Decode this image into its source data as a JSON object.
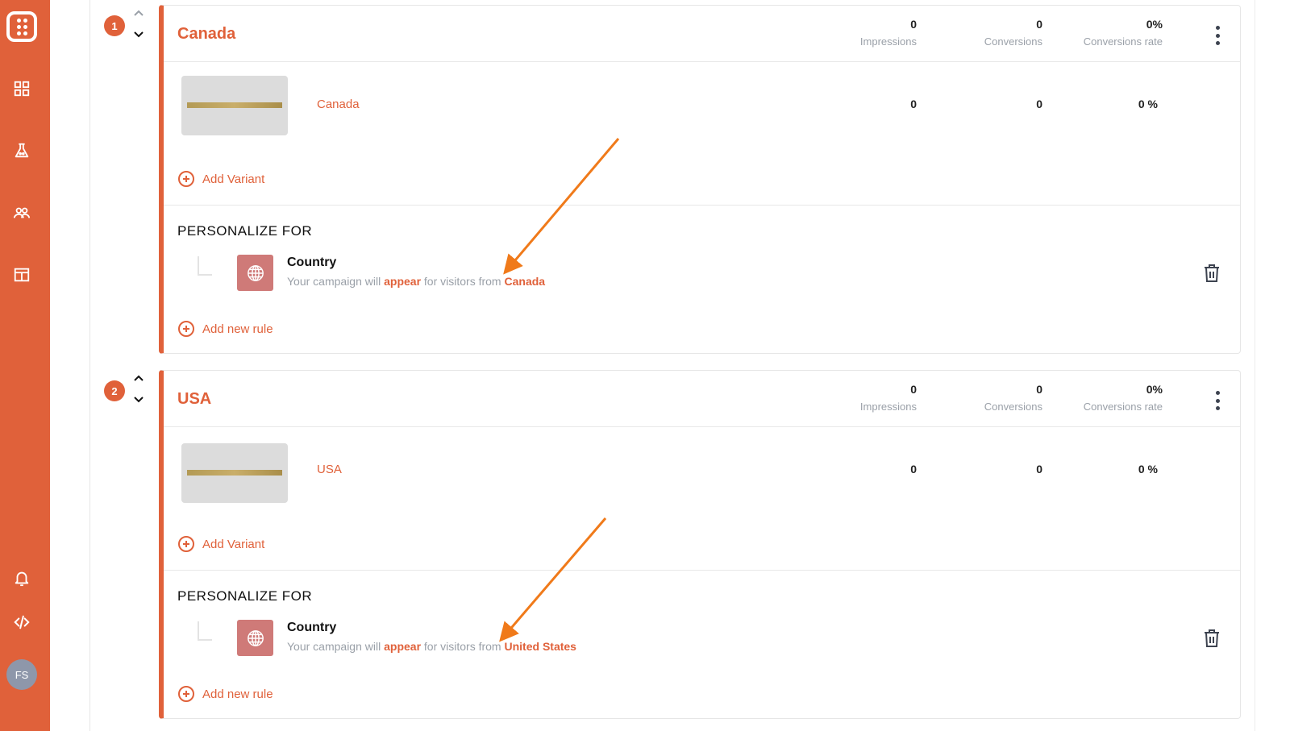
{
  "sidebar": {
    "logo": "dice-logo",
    "items": [
      {
        "icon": "dashboard-grid-icon"
      },
      {
        "icon": "flask-experiment-icon"
      },
      {
        "icon": "users-icon"
      },
      {
        "icon": "layout-template-icon"
      }
    ],
    "bottom": [
      {
        "icon": "bell-icon"
      },
      {
        "icon": "code-icon"
      }
    ],
    "avatar_initials": "FS"
  },
  "stat_labels": {
    "impressions": "Impressions",
    "conversions": "Conversions",
    "rate": "Conversions rate"
  },
  "campaigns": [
    {
      "order": "1",
      "title": "Canada",
      "stats": {
        "impressions": "0",
        "conversions": "0",
        "rate": "0%"
      },
      "variant": {
        "name": "Canada",
        "impressions": "0",
        "conversions": "0",
        "rate": "0 %"
      },
      "add_variant_label": "Add Variant",
      "personalize_title": "PERSONALIZE FOR",
      "rule": {
        "title": "Country",
        "desc_prefix": "Your campaign will ",
        "desc_action": "appear",
        "desc_middle": " for visitors from ",
        "desc_value": "Canada"
      },
      "add_rule_label": "Add new rule"
    },
    {
      "order": "2",
      "title": "USA",
      "stats": {
        "impressions": "0",
        "conversions": "0",
        "rate": "0%"
      },
      "variant": {
        "name": "USA",
        "impressions": "0",
        "conversions": "0",
        "rate": "0 %"
      },
      "add_variant_label": "Add Variant",
      "personalize_title": "PERSONALIZE FOR",
      "rule": {
        "title": "Country",
        "desc_prefix": "Your campaign will ",
        "desc_action": "appear",
        "desc_middle": " for visitors from ",
        "desc_value": "United States"
      },
      "add_rule_label": "Add new rule"
    }
  ],
  "colors": {
    "brand": "#e0613a",
    "rule_icon_bg": "#cf7a78",
    "annotation_arrow": "#f07a1a"
  }
}
